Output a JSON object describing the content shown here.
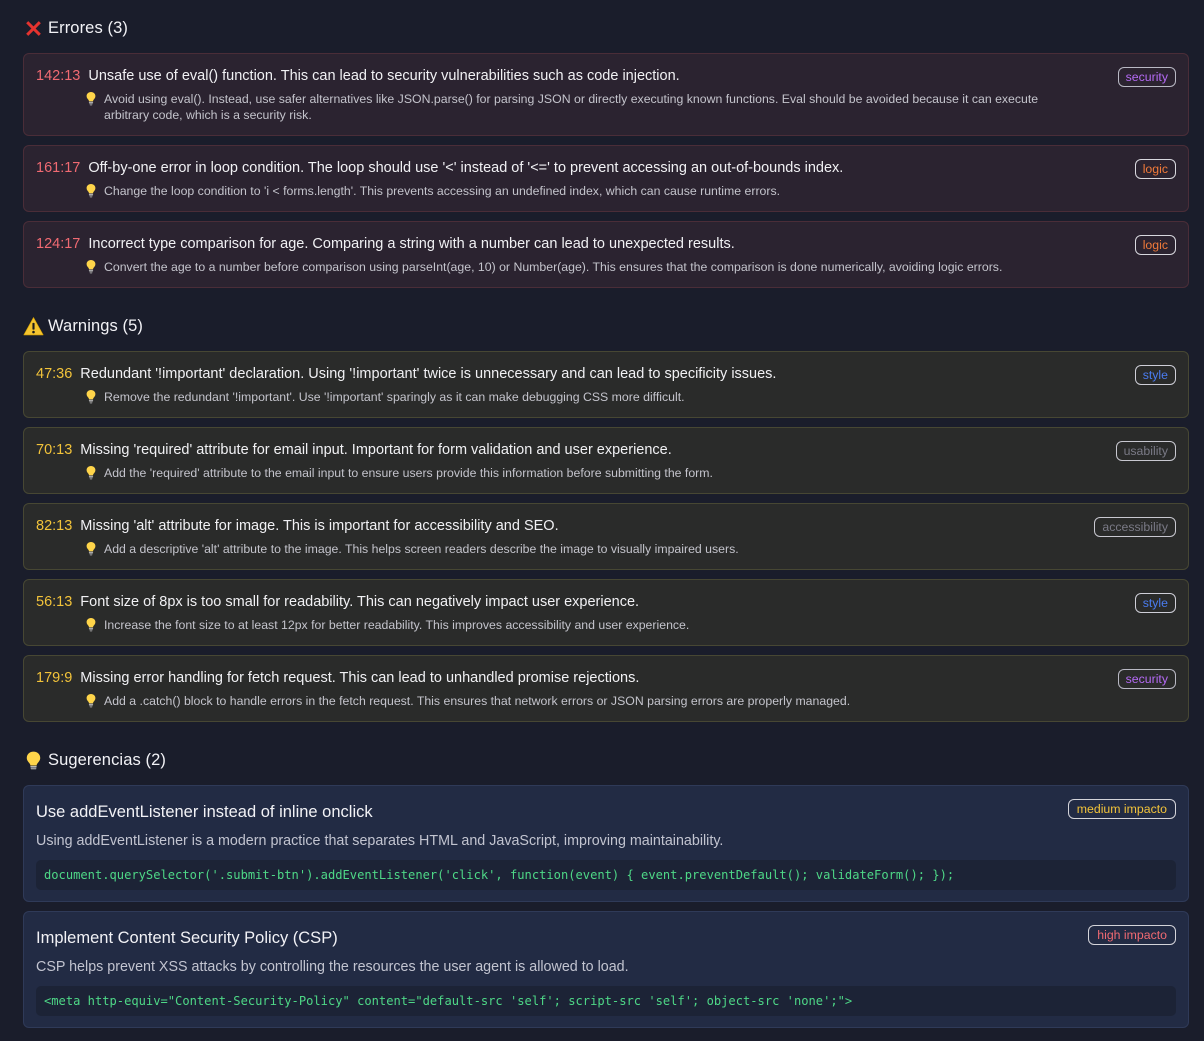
{
  "errors": {
    "title": "Errores (3)",
    "icon": "cross-mark-icon",
    "items": [
      {
        "loc": "142:13",
        "message": "Unsafe use of eval() function. This can lead to security vulnerabilities such as code injection.",
        "suggestion": "Avoid using eval(). Instead, use safer alternatives like JSON.parse() for parsing JSON or directly executing known functions. Eval should be avoided because it can execute arbitrary code, which is a security risk.",
        "tag": "security"
      },
      {
        "loc": "161:17",
        "message": "Off-by-one error in loop condition. The loop should use '<' instead of '<=' to prevent accessing an out-of-bounds index.",
        "suggestion": "Change the loop condition to 'i < forms.length'. This prevents accessing an undefined index, which can cause runtime errors.",
        "tag": "logic"
      },
      {
        "loc": "124:17",
        "message": "Incorrect type comparison for age. Comparing a string with a number can lead to unexpected results.",
        "suggestion": "Convert the age to a number before comparison using parseInt(age, 10) or Number(age). This ensures that the comparison is done numerically, avoiding logic errors.",
        "tag": "logic"
      }
    ]
  },
  "warnings": {
    "title": "Warnings (5)",
    "icon": "warning-triangle-icon",
    "items": [
      {
        "loc": "47:36",
        "message": "Redundant '!important' declaration. Using '!important' twice is unnecessary and can lead to specificity issues.",
        "suggestion": "Remove the redundant '!important'. Use '!important' sparingly as it can make debugging CSS more difficult.",
        "tag": "style"
      },
      {
        "loc": "70:13",
        "message": "Missing 'required' attribute for email input. Important for form validation and user experience.",
        "suggestion": "Add the 'required' attribute to the email input to ensure users provide this information before submitting the form.",
        "tag": "usability"
      },
      {
        "loc": "82:13",
        "message": "Missing 'alt' attribute for image. This is important for accessibility and SEO.",
        "suggestion": "Add a descriptive 'alt' attribute to the image. This helps screen readers describe the image to visually impaired users.",
        "tag": "accessibility"
      },
      {
        "loc": "56:13",
        "message": "Font size of 8px is too small for readability. This can negatively impact user experience.",
        "suggestion": "Increase the font size to at least 12px for better readability. This improves accessibility and user experience.",
        "tag": "style"
      },
      {
        "loc": "179:9",
        "message": "Missing error handling for fetch request. This can lead to unhandled promise rejections.",
        "suggestion": "Add a .catch() block to handle errors in the fetch request. This ensures that network errors or JSON parsing errors are properly managed.",
        "tag": "security"
      }
    ]
  },
  "suggestions": {
    "title": "Sugerencias (2)",
    "icon": "lightbulb-icon",
    "items": [
      {
        "title": "Use addEventListener instead of inline onclick",
        "impact": "medium impacto",
        "impact_level": "medium",
        "description": "Using addEventListener is a modern practice that separates HTML and JavaScript, improving maintainability.",
        "code": "document.querySelector('.submit-btn').addEventListener('click', function(event) { event.preventDefault(); validateForm(); });"
      },
      {
        "title": "Implement Content Security Policy (CSP)",
        "impact": "high impacto",
        "impact_level": "high",
        "description": "CSP helps prevent XSS attacks by controlling the resources the user agent is allowed to load.",
        "code": "<meta http-equiv=\"Content-Security-Policy\" content=\"default-src 'self'; script-src 'self'; object-src 'none';\">"
      }
    ]
  },
  "colors": {
    "background": "#1a1d2b",
    "error_accent": "#f06a72",
    "warning_accent": "#f2c33a",
    "code_green": "#4ed887",
    "tag_security": "#b56af5",
    "tag_logic": "#f07a3a",
    "tag_style": "#4a7cf0",
    "tag_muted": "#7a7a86"
  }
}
